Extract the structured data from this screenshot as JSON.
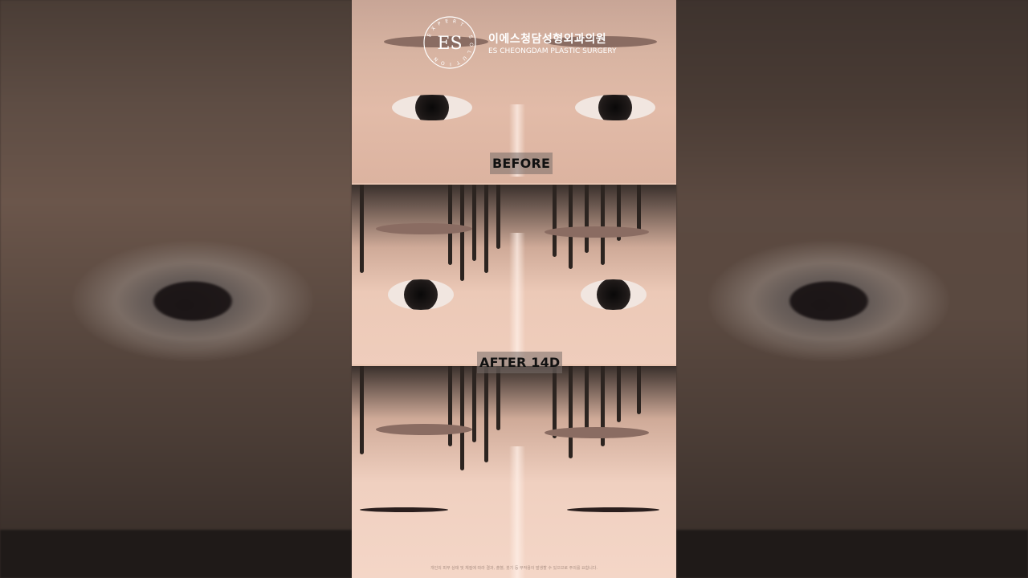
{
  "clinic": {
    "name_ko": "이에스청담성형외과의원",
    "name_en": "ES CHEONGDAM PLASTIC SURGERY",
    "logo_monogram": "ES",
    "logo_ring_text": "EXPERT SOLUTION"
  },
  "panels": [
    {
      "label": "BEFORE"
    },
    {
      "label": "AFTER 14D"
    }
  ],
  "disclaimer": "개인의 피부 상태 및 체질에 따라 결과, 출혈, 붓기 등 부작용이 발생할 수 있으므로 주의를 요합니다."
}
